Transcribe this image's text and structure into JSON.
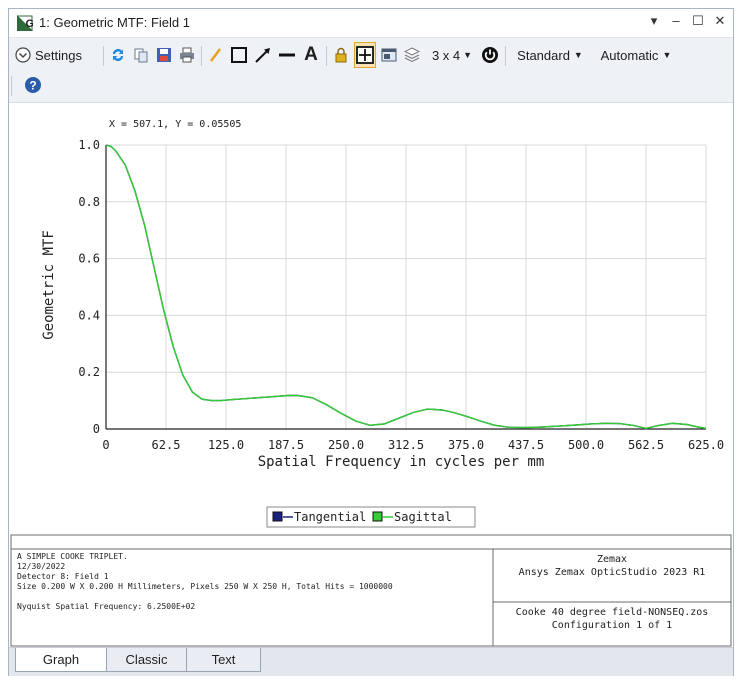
{
  "window": {
    "title": "1: Geometric MTF: Field 1",
    "icon_letter": "G"
  },
  "toolbar": {
    "settings_label": "Settings",
    "layout_label": "3 x 4",
    "standard_label": "Standard",
    "automatic_label": "Automatic"
  },
  "readout": "X = 507.1, Y = 0.05505",
  "chart_data": {
    "type": "line",
    "xlabel": "Spatial Frequency in cycles per mm",
    "ylabel": "Geometric MTF",
    "xlim": [
      0,
      625
    ],
    "ylim": [
      0,
      1
    ],
    "x_ticks": [
      "0",
      "62.5",
      "125.0",
      "187.5",
      "250.0",
      "312.5",
      "375.0",
      "437.5",
      "500.0",
      "562.5",
      "625.0"
    ],
    "y_ticks": [
      "0",
      "0.2",
      "0.4",
      "0.6",
      "0.8",
      "1.0"
    ],
    "grid": true,
    "legend_position": "bottom-center",
    "series": [
      {
        "name": "Tangential",
        "color": "#1a237e",
        "x": [
          0,
          5,
          10,
          20,
          30,
          40,
          50,
          60,
          70,
          80,
          90,
          100,
          110,
          120,
          130,
          150,
          170,
          190,
          200,
          215,
          230,
          245,
          260,
          275,
          290,
          305,
          320,
          335,
          350,
          362,
          375,
          390,
          405,
          420,
          437.5,
          455,
          470,
          490,
          505,
          520,
          535,
          550,
          562.5,
          575,
          590,
          605,
          615,
          625
        ],
        "y": [
          1.0,
          0.995,
          0.98,
          0.93,
          0.84,
          0.72,
          0.57,
          0.42,
          0.29,
          0.19,
          0.13,
          0.105,
          0.1,
          0.1,
          0.103,
          0.108,
          0.113,
          0.118,
          0.118,
          0.11,
          0.085,
          0.055,
          0.028,
          0.013,
          0.018,
          0.038,
          0.058,
          0.07,
          0.067,
          0.058,
          0.045,
          0.028,
          0.013,
          0.006,
          0.005,
          0.007,
          0.01,
          0.014,
          0.018,
          0.02,
          0.019,
          0.012,
          0.002,
          0.012,
          0.02,
          0.016,
          0.008,
          0.002
        ]
      },
      {
        "name": "Sagittal",
        "color": "#33cc33",
        "x": [
          0,
          5,
          10,
          20,
          30,
          40,
          50,
          60,
          70,
          80,
          90,
          100,
          110,
          120,
          130,
          150,
          170,
          190,
          200,
          215,
          230,
          245,
          260,
          275,
          290,
          305,
          320,
          335,
          350,
          362,
          375,
          390,
          405,
          420,
          437.5,
          455,
          470,
          490,
          505,
          520,
          535,
          550,
          562.5,
          575,
          590,
          605,
          615,
          625
        ],
        "y": [
          1.0,
          0.995,
          0.98,
          0.93,
          0.84,
          0.72,
          0.57,
          0.42,
          0.29,
          0.19,
          0.13,
          0.105,
          0.1,
          0.1,
          0.103,
          0.108,
          0.113,
          0.118,
          0.118,
          0.11,
          0.085,
          0.055,
          0.028,
          0.013,
          0.018,
          0.038,
          0.058,
          0.07,
          0.067,
          0.058,
          0.045,
          0.028,
          0.013,
          0.006,
          0.005,
          0.007,
          0.01,
          0.014,
          0.018,
          0.02,
          0.019,
          0.012,
          0.002,
          0.012,
          0.02,
          0.016,
          0.008,
          0.002
        ]
      }
    ]
  },
  "footer": {
    "left_lines": [
      "A SIMPLE COOKE TRIPLET.",
      "12/30/2022",
      "Detector 8: Field 1",
      "Size 0.200 W X 0.200 H Millimeters, Pixels 250 W X 250 H, Total Hits = 1000000"
    ],
    "nyquist": "Nyquist Spatial Frequency: 6.2500E+02",
    "vendor": "Zemax",
    "product": "Ansys Zemax OpticStudio 2023 R1",
    "file": "Cooke 40 degree field-NONSEQ.zos",
    "config": "Configuration 1 of 1"
  },
  "tabs": [
    "Graph",
    "Classic",
    "Text"
  ]
}
